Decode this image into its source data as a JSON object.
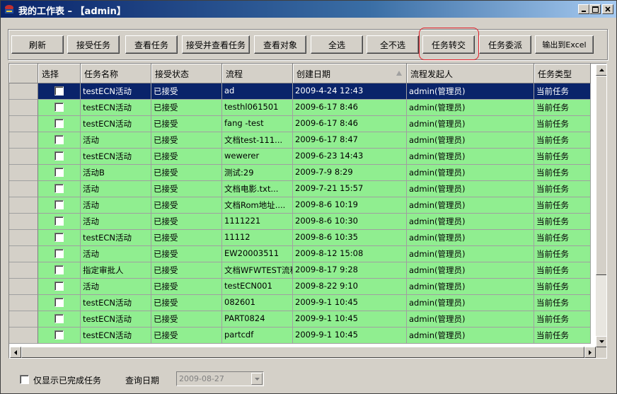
{
  "window": {
    "title": "我的工作表 – 【admin】",
    "icon": "app-icon",
    "controls": [
      "minimize-icon",
      "maximize-icon",
      "close-icon"
    ]
  },
  "toolbar": {
    "buttons": [
      "刷新",
      "接受任务",
      "查看任务",
      "接受并查看任务",
      "查看对象",
      "全选",
      "全不选",
      "任务转交",
      "任务委派",
      "输出到Excel"
    ],
    "highlighted": "任务转交",
    "highlight_color": "#e0202a"
  },
  "grid": {
    "columns": [
      "选择",
      "任务名称",
      "接受状态",
      "流程",
      "创建日期",
      "流程发起人",
      "任务类型"
    ],
    "sorted_column": "创建日期",
    "sort_direction": "ascending",
    "row_color": "#90ee90",
    "selected_row_color": "#0a246a",
    "selected_row_index": 0,
    "rows": [
      {
        "name": "testECN活动",
        "status": "已接受",
        "process": "ad",
        "date": "2009-4-24 12:43",
        "initiator": "admin(管理员)",
        "type": "当前任务"
      },
      {
        "name": "testECN活动",
        "status": "已接受",
        "process": "testhl061501",
        "date": "2009-6-17 8:46",
        "initiator": "admin(管理员)",
        "type": "当前任务"
      },
      {
        "name": "testECN活动",
        "status": "已接受",
        "process": "fang -test",
        "date": "2009-6-17 8:46",
        "initiator": "admin(管理员)",
        "type": "当前任务"
      },
      {
        "name": "活动",
        "status": "已接受",
        "process": "文档test-111...",
        "date": "2009-6-17 8:47",
        "initiator": "admin(管理员)",
        "type": "当前任务"
      },
      {
        "name": "testECN活动",
        "status": "已接受",
        "process": "wewerer",
        "date": "2009-6-23 14:43",
        "initiator": "admin(管理员)",
        "type": "当前任务"
      },
      {
        "name": "活动B",
        "status": "已接受",
        "process": "测试:29",
        "date": "2009-7-9 8:29",
        "initiator": "admin(管理员)",
        "type": "当前任务"
      },
      {
        "name": "活动",
        "status": "已接受",
        "process": "文档电影.txt...",
        "date": "2009-7-21 15:57",
        "initiator": "admin(管理员)",
        "type": "当前任务"
      },
      {
        "name": "活动",
        "status": "已接受",
        "process": "文档Rom地址....",
        "date": "2009-8-6 10:19",
        "initiator": "admin(管理员)",
        "type": "当前任务"
      },
      {
        "name": "活动",
        "status": "已接受",
        "process": "1111221",
        "date": "2009-8-6 10:30",
        "initiator": "admin(管理员)",
        "type": "当前任务"
      },
      {
        "name": "testECN活动",
        "status": "已接受",
        "process": "11112",
        "date": "2009-8-6 10:35",
        "initiator": "admin(管理员)",
        "type": "当前任务"
      },
      {
        "name": "活动",
        "status": "已接受",
        "process": "EW20003511",
        "date": "2009-8-12 15:08",
        "initiator": "admin(管理员)",
        "type": "当前任务"
      },
      {
        "name": "指定审批人",
        "status": "已接受",
        "process": "文档WFWTEST流程",
        "date": "2009-8-17 9:28",
        "initiator": "admin(管理员)",
        "type": "当前任务"
      },
      {
        "name": "活动",
        "status": "已接受",
        "process": "testECN001",
        "date": "2009-8-22 9:10",
        "initiator": "admin(管理员)",
        "type": "当前任务"
      },
      {
        "name": "testECN活动",
        "status": "已接受",
        "process": "082601",
        "date": "2009-9-1 10:45",
        "initiator": "admin(管理员)",
        "type": "当前任务"
      },
      {
        "name": "testECN活动",
        "status": "已接受",
        "process": "PART0824",
        "date": "2009-9-1 10:45",
        "initiator": "admin(管理员)",
        "type": "当前任务"
      },
      {
        "name": "testECN活动",
        "status": "已接受",
        "process": "partcdf",
        "date": "2009-9-1 10:45",
        "initiator": "admin(管理员)",
        "type": "当前任务"
      }
    ]
  },
  "footer": {
    "show_completed_label": "仅显示已完成任务",
    "show_completed_checked": false,
    "query_date_label": "查询日期",
    "query_date_value": "2009-08-27",
    "query_date_enabled": false
  }
}
